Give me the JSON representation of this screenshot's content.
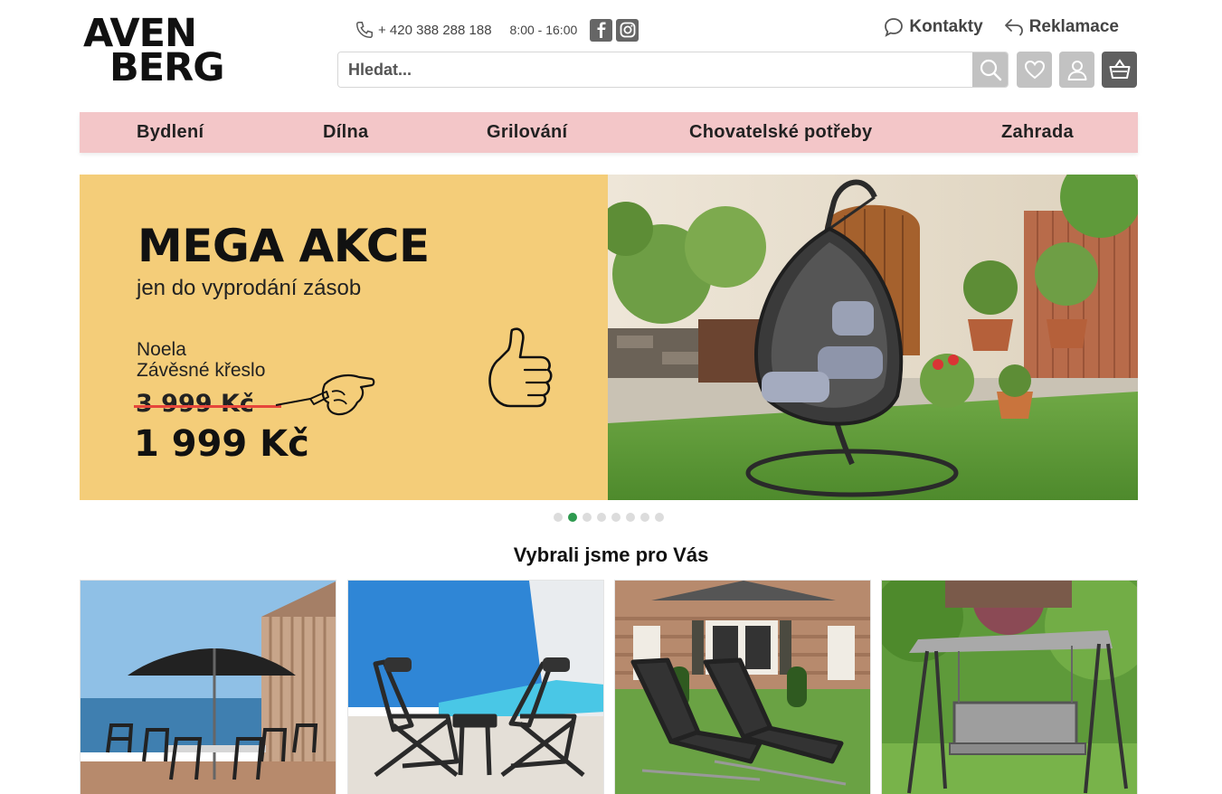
{
  "brand": {
    "line1": "AVEN",
    "line2": "BERG"
  },
  "contact": {
    "phone": "+ 420 388 288 188",
    "hours": "8:00 - 16:00",
    "social": [
      "facebook-icon",
      "instagram-icon"
    ]
  },
  "top_links": [
    {
      "label": "Kontakty",
      "icon": "chat-bubble-icon"
    },
    {
      "label": "Reklamace",
      "icon": "return-arrow-icon"
    }
  ],
  "search": {
    "placeholder": "Hledat..."
  },
  "header_icons": [
    "search-icon",
    "heart-icon",
    "user-icon",
    "basket-icon"
  ],
  "nav": {
    "items": [
      "Bydlení",
      "Dílna",
      "Grilování",
      "Chovatelské potřeby",
      "Zahrada"
    ]
  },
  "banner": {
    "headline": "MEGA AKCE",
    "subtitle": "jen do vyprodání zásob",
    "product_line1": "Noela",
    "product_line2": "Závěsné křeslo",
    "old_price": "3 999 Kč",
    "new_price": "1 999 Kč",
    "slide_count": 8,
    "active_slide": 2
  },
  "section": {
    "title": "Vybrali jsme pro Vás"
  },
  "colors": {
    "nav_bg": "#f3c6c8",
    "banner_bg": "#f4cd79",
    "active_dot": "#2e9a4f",
    "price_strike": "#e6463b"
  }
}
